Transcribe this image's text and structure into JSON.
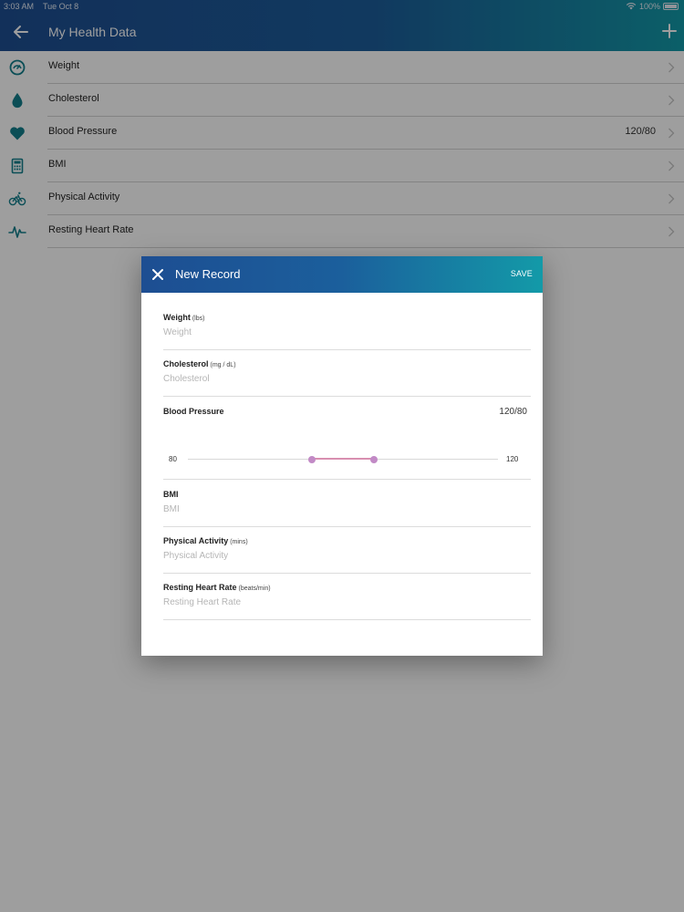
{
  "status_bar": {
    "time": "3:03 AM",
    "date": "Tue Oct 8",
    "battery": "100%"
  },
  "header": {
    "title": "My Health Data"
  },
  "list": {
    "items": [
      {
        "label": "Weight",
        "icon": "scale-icon",
        "value": ""
      },
      {
        "label": "Cholesterol",
        "icon": "drop-icon",
        "value": ""
      },
      {
        "label": "Blood Pressure",
        "icon": "heart-icon",
        "value": "120/80"
      },
      {
        "label": "BMI",
        "icon": "calculator-icon",
        "value": ""
      },
      {
        "label": "Physical Activity",
        "icon": "bicycle-icon",
        "value": ""
      },
      {
        "label": "Resting Heart Rate",
        "icon": "heartbeat-icon",
        "value": ""
      }
    ]
  },
  "dialog": {
    "title": "New Record",
    "save_label": "SAVE",
    "fields": {
      "weight": {
        "label": "Weight",
        "unit": "(lbs)",
        "placeholder": "Weight",
        "value": ""
      },
      "cholesterol": {
        "label": "Cholesterol",
        "unit": "(mg / dL)",
        "placeholder": "Cholesterol",
        "value": ""
      },
      "bmi": {
        "label": "BMI",
        "unit": "",
        "placeholder": "BMI",
        "value": ""
      },
      "activity": {
        "label": "Physical Activity",
        "unit": "(mins)",
        "placeholder": "Physical Activity",
        "value": ""
      },
      "heart_rate": {
        "label": "Resting Heart Rate",
        "unit": "(beats/min)",
        "placeholder": "Resting Heart Rate",
        "value": ""
      }
    },
    "blood_pressure": {
      "label": "Blood Pressure",
      "value": "120/80",
      "min_label": "80",
      "max_label": "120",
      "low_fraction": 0.4,
      "high_fraction": 0.6
    }
  },
  "colors": {
    "accent_teal": "#139aa8",
    "header_blue": "#1d4e92",
    "slider_pink": "#d88fb0",
    "icon_teal": "#127f8c"
  }
}
